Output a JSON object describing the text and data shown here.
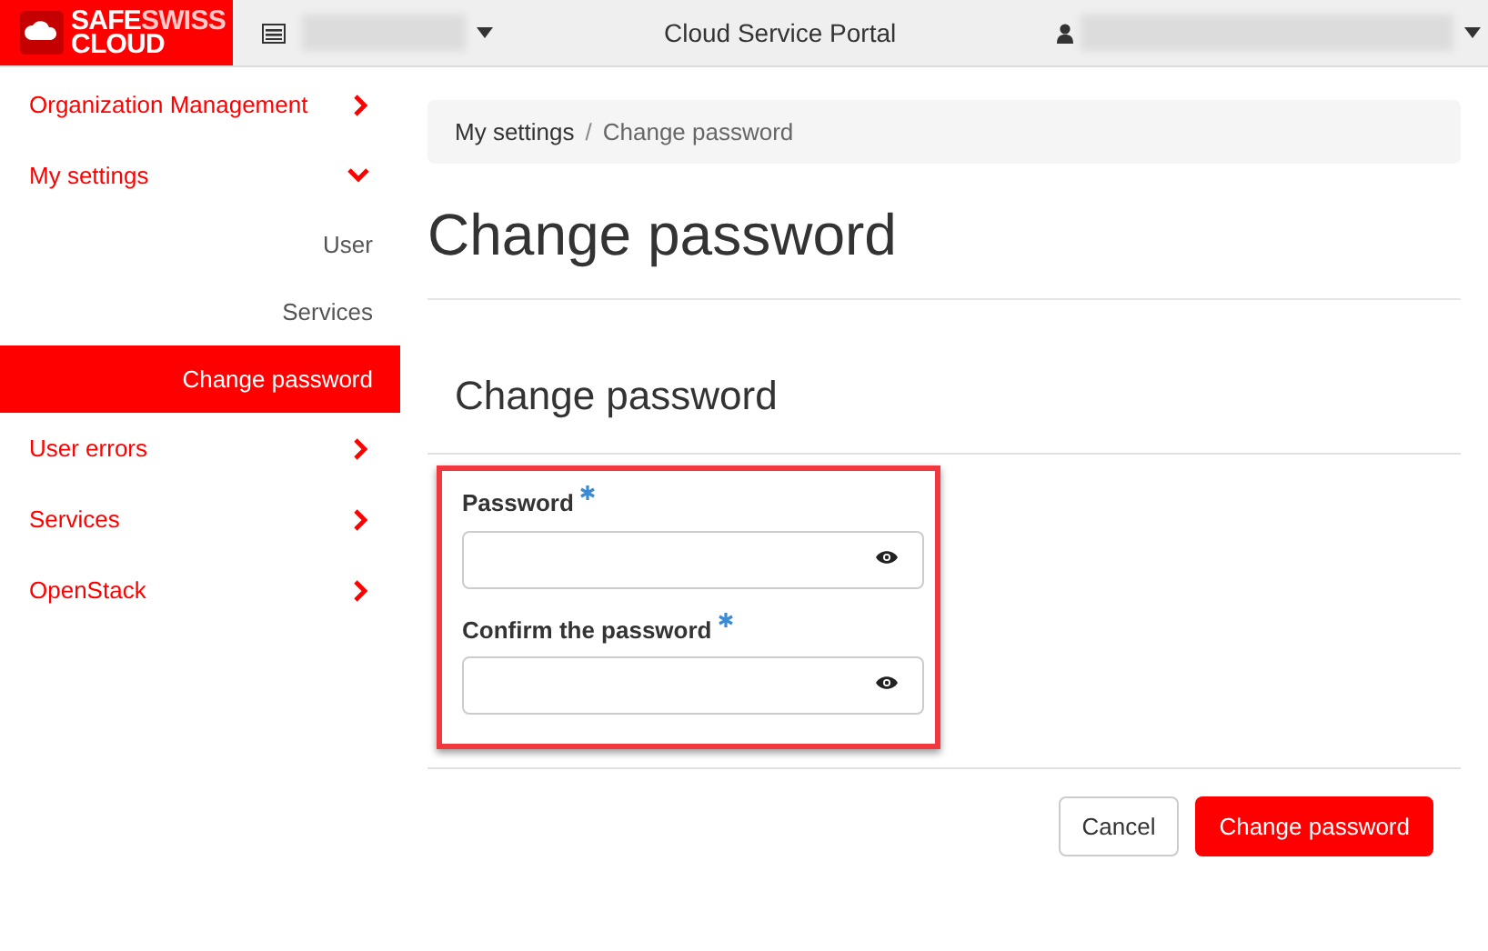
{
  "header": {
    "logo": [
      "SAFE",
      "SWISS",
      "CLOUD"
    ],
    "title": "Cloud Service Portal"
  },
  "sidebar": {
    "items": [
      {
        "label": "Organization Management",
        "expanded": false,
        "selected": false
      },
      {
        "label": "My settings",
        "expanded": true,
        "selected": false,
        "children": [
          {
            "label": "User",
            "selected": false
          },
          {
            "label": "Services",
            "selected": false
          },
          {
            "label": "Change password",
            "selected": true
          }
        ]
      },
      {
        "label": "User errors",
        "expanded": false,
        "selected": false
      },
      {
        "label": "Services",
        "expanded": false,
        "selected": false
      },
      {
        "label": "OpenStack",
        "expanded": false,
        "selected": false
      }
    ]
  },
  "breadcrumb": [
    "My settings",
    "/",
    "Change password"
  ],
  "page_title": "Change password",
  "form": {
    "title": "Change password",
    "fields": [
      {
        "label": "Password",
        "required": true
      },
      {
        "label": "Confirm the password",
        "required": true
      }
    ],
    "buttons": [
      {
        "label": "Cancel",
        "kind": "secondary"
      },
      {
        "label": "Change password",
        "kind": "primary"
      }
    ]
  }
}
